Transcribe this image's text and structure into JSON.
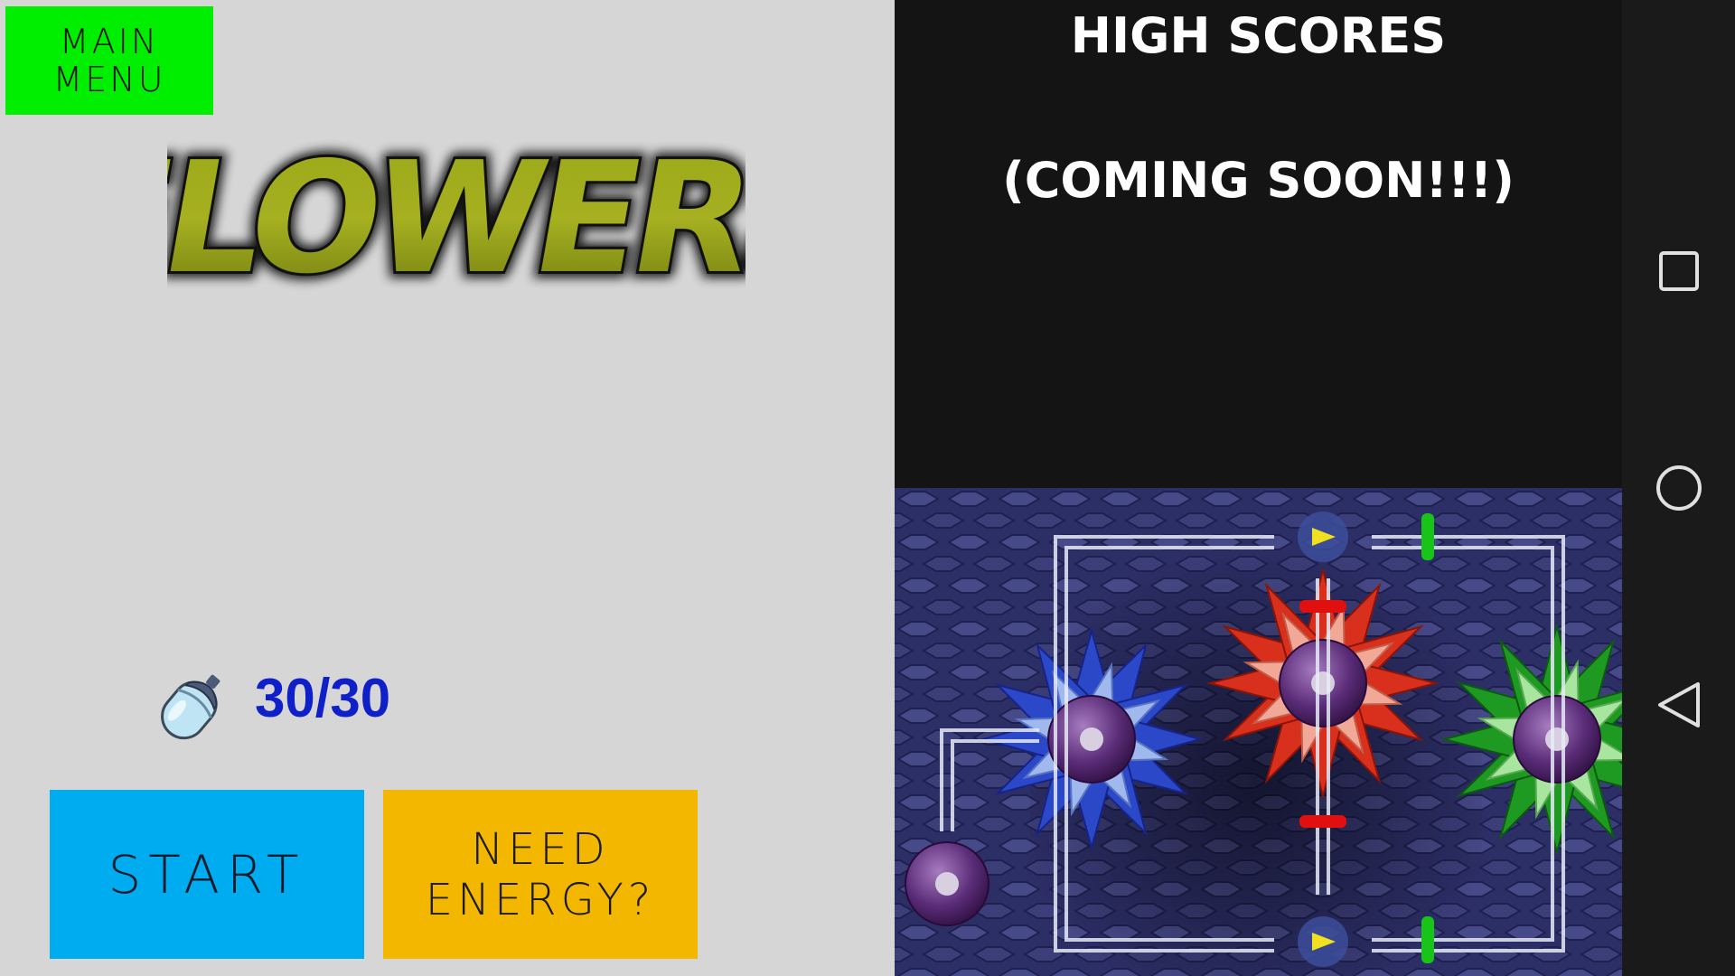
{
  "menu": {
    "main_menu_label": "MAIN\nMENU"
  },
  "game": {
    "title": "FLOWERS"
  },
  "energy": {
    "count": "30/30",
    "icon": "energy-capsule-icon"
  },
  "buttons": {
    "start_label": "START",
    "need_energy_label": "NEED\nENERGY?"
  },
  "scores": {
    "title": "HIGH SCORES",
    "subtitle": "(COMING SOON!!!)"
  },
  "nav": {
    "recents": "recents-square-icon",
    "home": "home-circle-icon",
    "back": "back-triangle-icon"
  },
  "colors": {
    "main_menu": "#00ee00",
    "start": "#00acf0",
    "need_energy": "#f3b700",
    "energy_text": "#1020c8",
    "scores_bg": "#141414"
  }
}
